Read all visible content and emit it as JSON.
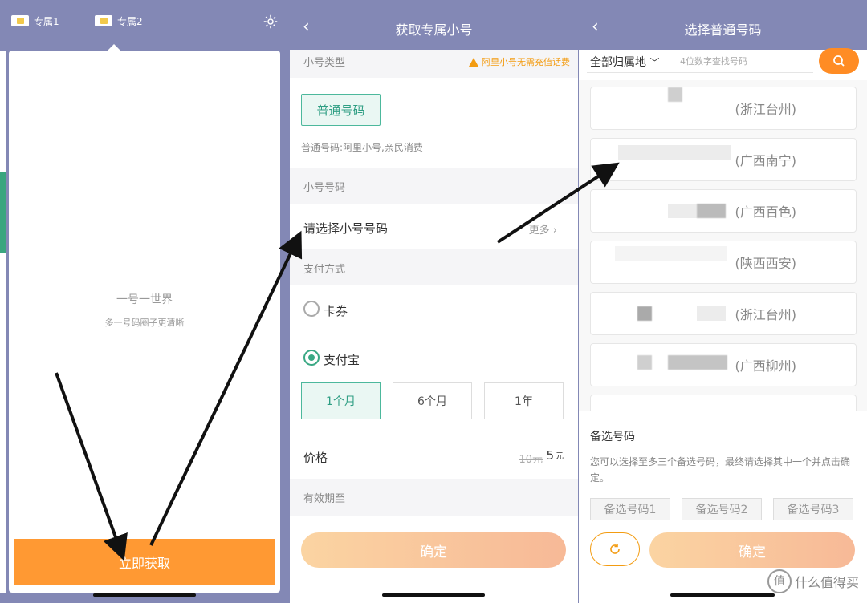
{
  "panel1": {
    "sims": [
      "专属1",
      "专属2"
    ],
    "slogan": "一号一世界",
    "subtitle": "多一号码圈子更清晰",
    "get_button": "立即获取"
  },
  "panel2": {
    "title": "获取专属小号",
    "back_icon": "‹",
    "type_section": "小号类型",
    "notice": "阿里小号无需充值话费",
    "plain_number_button": "普通号码",
    "plain_desc": "普通号码:阿里小号,亲民消费",
    "number_section": "小号号码",
    "choose_number": "请选择小号号码",
    "more": "更多 ›",
    "pay_section": "支付方式",
    "pay_methods": [
      {
        "label": "卡券",
        "selected": false
      },
      {
        "label": "支付宝",
        "selected": true
      }
    ],
    "periods": [
      {
        "label": "1个月",
        "selected": true
      },
      {
        "label": "6个月",
        "selected": false
      },
      {
        "label": "1年",
        "selected": false
      }
    ],
    "price_label": "价格",
    "old_price": "10元",
    "new_price": "5",
    "currency": "元",
    "valid_label": "有效期至",
    "confirm": "确定"
  },
  "panel3": {
    "title": "选择普通号码",
    "back_icon": "‹",
    "area_select": "全部归属地",
    "search_placeholder": "4位数字查找号码",
    "numbers": [
      {
        "location": "(浙江台州)"
      },
      {
        "location": "(广西南宁)"
      },
      {
        "location": "(广西百色)"
      },
      {
        "location": "(陕西西安)"
      },
      {
        "location": "(浙江台州)"
      },
      {
        "location": "(广西柳州)"
      }
    ],
    "alt_title": "备选号码",
    "alt_desc": "您可以选择至多三个备选号码，最终请选择其中一个并点击确定。",
    "alt_buttons": [
      "备选号码1",
      "备选号码2",
      "备选号码3"
    ],
    "confirm": "确定",
    "watermark": "什么值得买",
    "watermark_glyph": "值"
  },
  "colors": {
    "nav": "#8388b5",
    "accent_orange": "#ff9933",
    "accent_green": "#3aa884"
  }
}
